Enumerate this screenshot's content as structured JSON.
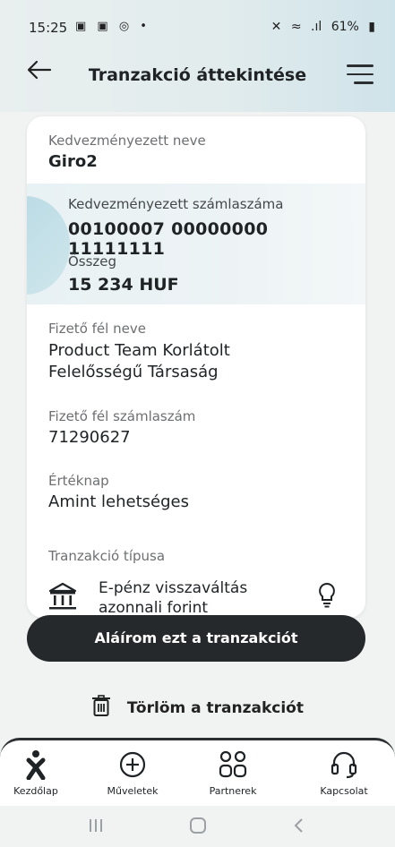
{
  "status_bar": {
    "time": "15:25",
    "left_icons": "▣ ▣ ◎ •",
    "mute": "✕",
    "wifi": "≈",
    "signal": ".ıl",
    "battery": "61%"
  },
  "header": {
    "title": "Tranzakció áttekintése",
    "back_icon": "arrow-left-icon",
    "menu_icon": "menu-icon"
  },
  "card": {
    "beneficiary_name_label": "Kedvezményezett neve",
    "beneficiary_name": "Giro2",
    "beneficiary_account_label": "Kedvezményezett számlaszáma",
    "beneficiary_account": "00100007 00000000 11111111",
    "amount_label": "Összeg",
    "amount": "15 234 HUF",
    "payer_name_label": "Fizető fél neve",
    "payer_name_line1": "Product Team Korlátolt",
    "payer_name_line2": "Felelősségű Társaság",
    "payer_account_label": "Fizető fél számlaszám",
    "payer_account": "71290627",
    "value_date_label": "Értéknap",
    "value_date": "Amint lehetséges",
    "tx_type_label": "Tranzakció típusa",
    "tx_type_line1": "E-pénz visszaváltás",
    "tx_type_line2": "azonnali forint"
  },
  "actions": {
    "sign_label": "Aláírom ezt a tranzakciót",
    "delete_label": "Törlöm a tranzakciót"
  },
  "bottom_nav": [
    {
      "label": "Kezdőlap",
      "icon": "home-person-icon"
    },
    {
      "label": "Műveletek",
      "icon": "plus-circle-icon"
    },
    {
      "label": "Partnerek",
      "icon": "partners-icon"
    },
    {
      "label": "Kapcsolat",
      "icon": "headset-icon"
    }
  ],
  "colors": {
    "accent_dark": "#26292b",
    "highlight": "#e8f1f4",
    "circle": "#b6d8e3"
  }
}
